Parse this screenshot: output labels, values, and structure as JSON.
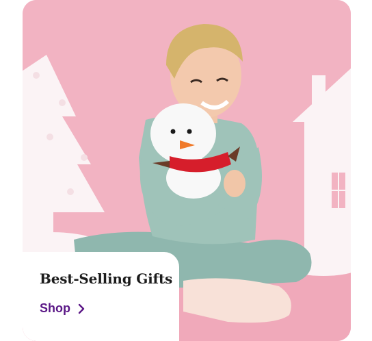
{
  "promo": {
    "title": "Best-Selling Gifts",
    "link_label": "Shop",
    "link_icon": "chevron-right-icon",
    "image_subject": "child in pajamas hugging a plush snowman",
    "colors": {
      "background": "#f2b3c2",
      "title": "#1c1c1c",
      "link": "#5a1786",
      "card": "#ffffff"
    }
  }
}
